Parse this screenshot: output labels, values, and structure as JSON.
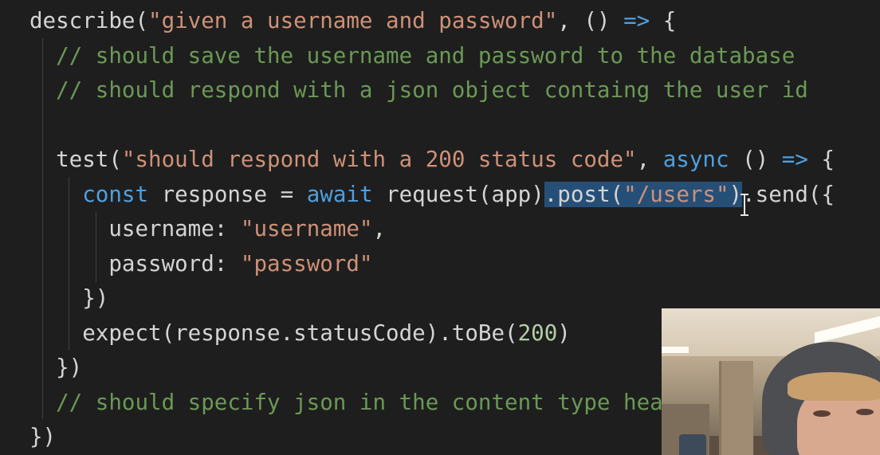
{
  "editor": {
    "lines": [
      {
        "tokens": [
          {
            "t": "describe(",
            "c": "plain"
          },
          {
            "t": "\"given a username and password\"",
            "c": "str"
          },
          {
            "t": ", () ",
            "c": "plain"
          },
          {
            "t": "=>",
            "c": "kw"
          },
          {
            "t": " {",
            "c": "plain"
          }
        ]
      },
      {
        "tokens": [
          {
            "t": "  // should save the username and password to the database",
            "c": "cmt"
          }
        ]
      },
      {
        "tokens": [
          {
            "t": "  // should respond with a json object containg the user id",
            "c": "cmt"
          }
        ]
      },
      {
        "tokens": []
      },
      {
        "tokens": [
          {
            "t": "  test(",
            "c": "plain"
          },
          {
            "t": "\"should respond with a 200 status code\"",
            "c": "str"
          },
          {
            "t": ", ",
            "c": "plain"
          },
          {
            "t": "async",
            "c": "kw"
          },
          {
            "t": " () ",
            "c": "plain"
          },
          {
            "t": "=>",
            "c": "kw"
          },
          {
            "t": " {",
            "c": "plain"
          }
        ]
      },
      {
        "tokens": [
          {
            "t": "    ",
            "c": "plain"
          },
          {
            "t": "const",
            "c": "kw"
          },
          {
            "t": " response = ",
            "c": "plain"
          },
          {
            "t": "await",
            "c": "kw"
          },
          {
            "t": " request(app)",
            "c": "plain"
          },
          {
            "t": ".post(",
            "c": "plain",
            "sel": true
          },
          {
            "t": "\"/users\"",
            "c": "str",
            "sel": true
          },
          {
            "t": ")",
            "c": "plain",
            "sel": true
          },
          {
            "t": ".send({",
            "c": "plain"
          }
        ]
      },
      {
        "tokens": [
          {
            "t": "      username: ",
            "c": "plain"
          },
          {
            "t": "\"username\"",
            "c": "str"
          },
          {
            "t": ",",
            "c": "plain"
          }
        ]
      },
      {
        "tokens": [
          {
            "t": "      password: ",
            "c": "plain"
          },
          {
            "t": "\"password\"",
            "c": "str"
          }
        ]
      },
      {
        "tokens": [
          {
            "t": "    })",
            "c": "plain"
          }
        ]
      },
      {
        "tokens": [
          {
            "t": "    expect(response.statusCode).toBe(",
            "c": "plain"
          },
          {
            "t": "200",
            "c": "num"
          },
          {
            "t": ")",
            "c": "plain"
          }
        ]
      },
      {
        "tokens": [
          {
            "t": "  })",
            "c": "plain"
          }
        ]
      },
      {
        "tokens": [
          {
            "t": "  // should specify json in the content type hea",
            "c": "cmt"
          }
        ]
      },
      {
        "tokens": [
          {
            "t": "})",
            "c": "plain"
          }
        ]
      }
    ]
  }
}
